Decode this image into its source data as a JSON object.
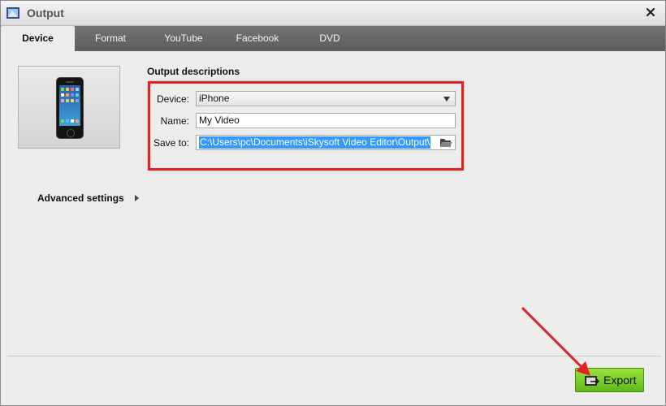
{
  "window": {
    "title": "Output"
  },
  "tabs": [
    {
      "label": "Device",
      "active": true
    },
    {
      "label": "Format",
      "active": false
    },
    {
      "label": "YouTube",
      "active": false
    },
    {
      "label": "Facebook",
      "active": false
    },
    {
      "label": "DVD",
      "active": false
    }
  ],
  "output": {
    "section_title": "Output descriptions",
    "device_label": "Device:",
    "device_value": "iPhone",
    "name_label": "Name:",
    "name_value": "My Video",
    "save_label": "Save to:",
    "save_value": "C:\\Users\\pc\\Documents\\iSkysoft Video Editor\\Output\\"
  },
  "advanced": {
    "label": "Advanced settings"
  },
  "export": {
    "label": "Export"
  },
  "colors": {
    "accent_green": "#6cc421",
    "highlight_red": "#e02323",
    "tab_bar": "#666666",
    "selection_blue": "#3399ff"
  },
  "icons": [
    "app-icon",
    "close-icon",
    "phone-icon",
    "folder-icon",
    "export-icon",
    "chevron-right-icon"
  ]
}
